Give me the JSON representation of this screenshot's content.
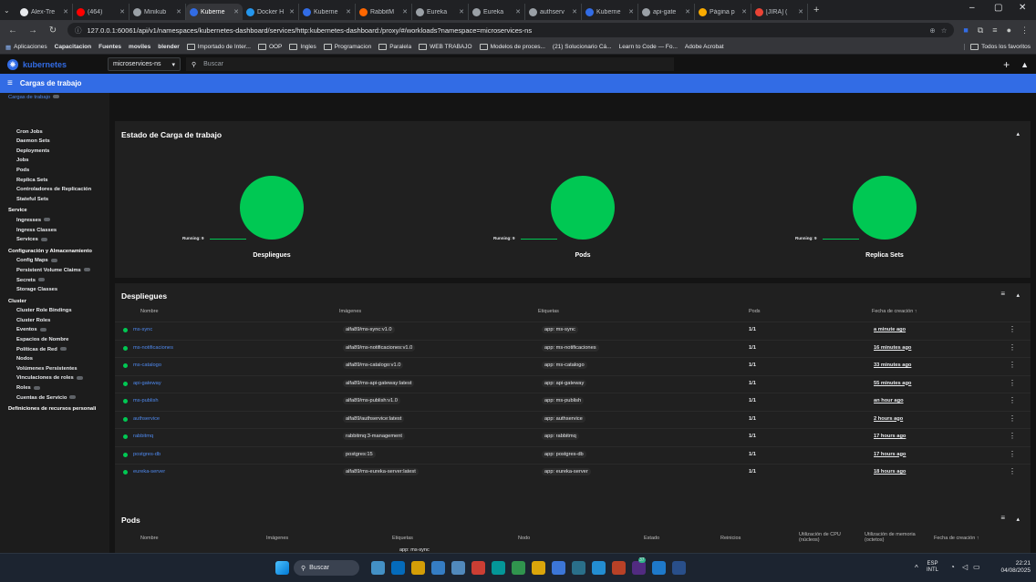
{
  "browser": {
    "tabs": [
      {
        "label": "Alex-Tre",
        "color": "#e8eaed",
        "active": false
      },
      {
        "label": "(464)",
        "color": "#ff0000",
        "active": false
      },
      {
        "label": "Minikub",
        "color": "#9aa0a6",
        "active": false
      },
      {
        "label": "Kuberne",
        "color": "#326ce5",
        "active": true
      },
      {
        "label": "Docker H",
        "color": "#2496ed",
        "active": false
      },
      {
        "label": "Kuberne",
        "color": "#326ce5",
        "active": false
      },
      {
        "label": "RabbitM",
        "color": "#ff6600",
        "active": false
      },
      {
        "label": "Eureka",
        "color": "#9aa0a6",
        "active": false
      },
      {
        "label": "Eureka",
        "color": "#9aa0a6",
        "active": false
      },
      {
        "label": "authserv",
        "color": "#9aa0a6",
        "active": false
      },
      {
        "label": "Kuberne",
        "color": "#326ce5",
        "active": false
      },
      {
        "label": "api-gate",
        "color": "#9aa0a6",
        "active": false
      },
      {
        "label": "Página p",
        "color": "#f9ab00",
        "active": false
      },
      {
        "label": "[JIRA] (",
        "color": "#ea4335",
        "active": false
      }
    ],
    "url": "127.0.0.1:60061/api/v1/namespaces/kubernetes-dashboard/services/http:kubernetes-dashboard:/proxy/#/workloads?namespace=microservices-ns",
    "bookmarks": [
      "Aplicaciones",
      "Capacitacion",
      "Fuentes",
      "moviles",
      "blender",
      "Importado de Inter...",
      "OOP",
      "Ingles",
      "Programacion",
      "Paralela",
      "WEB TRABAJO",
      "Modelos de proces...",
      "(21) Solucionario Cá...",
      "Learn to Code — Fo...",
      "Adobe Acrobat"
    ],
    "all_bookmarks": "Todos los favoritos"
  },
  "k8s": {
    "logo": "kubernetes",
    "namespace": "microservices-ns",
    "search_placeholder": "Buscar",
    "section_title": "Cargas de trabajo"
  },
  "sidebar": [
    {
      "label": "Cargas de trabajo",
      "type": "header-active",
      "count": true
    },
    {
      "label": "Cron Jobs",
      "type": "item"
    },
    {
      "label": "Daemon Sets",
      "type": "item"
    },
    {
      "label": "Deployments",
      "type": "item"
    },
    {
      "label": "Jobs",
      "type": "item"
    },
    {
      "label": "Pods",
      "type": "item"
    },
    {
      "label": "Replica Sets",
      "type": "item"
    },
    {
      "label": "Controladores de Replicación",
      "type": "item"
    },
    {
      "label": "Stateful Sets",
      "type": "item"
    },
    {
      "label": "Service",
      "type": "header"
    },
    {
      "label": "Ingresses",
      "type": "item",
      "count": true
    },
    {
      "label": "Ingress Classes",
      "type": "item"
    },
    {
      "label": "Services",
      "type": "item",
      "count": true
    },
    {
      "label": "Configuración y Almacenamiento",
      "type": "header"
    },
    {
      "label": "Config Maps",
      "type": "item",
      "count": true
    },
    {
      "label": "Persistent Volume Claims",
      "type": "item",
      "count": true
    },
    {
      "label": "Secrets",
      "type": "item",
      "count": true
    },
    {
      "label": "Storage Classes",
      "type": "item"
    },
    {
      "label": "Cluster",
      "type": "header"
    },
    {
      "label": "Cluster Role Bindings",
      "type": "item"
    },
    {
      "label": "Cluster Roles",
      "type": "item"
    },
    {
      "label": "Eventos",
      "type": "item",
      "count": true
    },
    {
      "label": "Espacios de Nombre",
      "type": "item"
    },
    {
      "label": "Políticas de Red",
      "type": "item",
      "count": true
    },
    {
      "label": "Nodos",
      "type": "item"
    },
    {
      "label": "Volúmenes Persistentes",
      "type": "item"
    },
    {
      "label": "Vinculaciones de roles",
      "type": "item",
      "count": true
    },
    {
      "label": "Roles",
      "type": "item",
      "count": true
    },
    {
      "label": "Cuentas de Servicio",
      "type": "item",
      "count": true
    },
    {
      "label": "Definiciones de recursos personali",
      "type": "header"
    }
  ],
  "status_card": {
    "title": "Estado de Carga de trabajo",
    "charts": [
      {
        "label": "Despliegues",
        "legend": "Running: 9"
      },
      {
        "label": "Pods",
        "legend": "Running: 9"
      },
      {
        "label": "Replica Sets",
        "legend": "Running: 9"
      }
    ]
  },
  "deployments": {
    "title": "Despliegues",
    "headers": {
      "name": "Nombre",
      "images": "Imágenes",
      "labels": "Etiquetas",
      "pods": "Pods",
      "created": "Fecha de creación ↑"
    },
    "rows": [
      {
        "name": "ms-sync",
        "image": "alfa89/ms-sync:v1.0",
        "label": "app: ms-sync",
        "pods": "1/1",
        "created": "a minute ago"
      },
      {
        "name": "ms-notificaciones",
        "image": "alfa89/ms-notificaciones:v1.0",
        "label": "app: ms-notificaciones",
        "pods": "1/1",
        "created": "16 minutes ago"
      },
      {
        "name": "ms-catalogo",
        "image": "alfa89/ms-catalogo:v1.0",
        "label": "app: ms-catalogo",
        "pods": "1/1",
        "created": "33 minutes ago"
      },
      {
        "name": "api-gateway",
        "image": "alfa89/ms-api-gateway:latest",
        "label": "app: api-gateway",
        "pods": "1/1",
        "created": "55 minutes ago"
      },
      {
        "name": "ms-publish",
        "image": "alfa89/ms-publish:v1.0",
        "label": "app: ms-publish",
        "pods": "1/1",
        "created": "an hour ago"
      },
      {
        "name": "authservice",
        "image": "alfa89/authservice:latest",
        "label": "app: authservice",
        "pods": "1/1",
        "created": "2 hours ago"
      },
      {
        "name": "rabbitmq",
        "image": "rabbitmq:3-management",
        "label": "app: rabbitmq",
        "pods": "1/1",
        "created": "17 hours ago"
      },
      {
        "name": "postgres-db",
        "image": "postgres:15",
        "label": "app: postgres-db",
        "pods": "1/1",
        "created": "17 hours ago"
      },
      {
        "name": "eureka-server",
        "image": "alfa89/ms-eureka-server:latest",
        "label": "app: eureka-server",
        "pods": "1/1",
        "created": "18 hours ago"
      }
    ]
  },
  "pods_card": {
    "title": "Pods",
    "headers": {
      "name": "Nombre",
      "images": "Imágenes",
      "labels": "Etiquetas",
      "node": "Nodo",
      "state": "Estado",
      "restarts": "Reinicios",
      "cpu": "Utilización de CPU",
      "cpu_sub": "(núcleos)",
      "mem": "Utilización de memoria",
      "mem_sub": "(octetos)",
      "created": "Fecha de creación ↑"
    },
    "first_label": "app: ms-sync"
  },
  "taskbar": {
    "search": "Buscar",
    "lang": "ESP",
    "lang_sub": "INTL",
    "time": "22:21",
    "date": "04/08/2025",
    "badge": "37"
  }
}
